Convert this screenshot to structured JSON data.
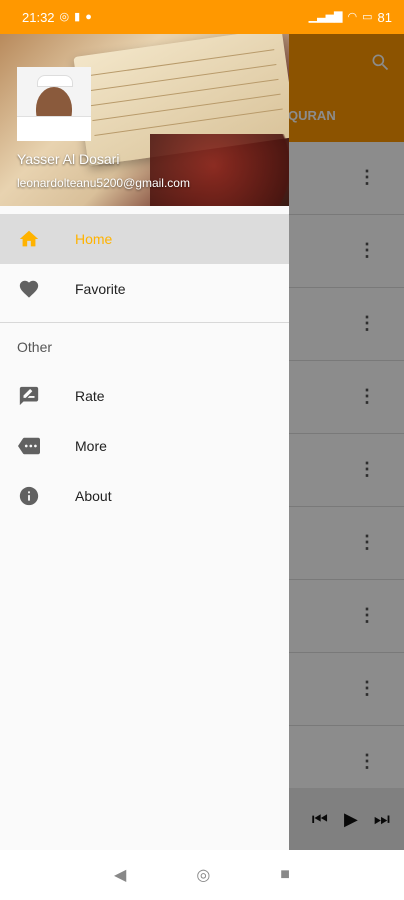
{
  "status": {
    "time": "21:32",
    "battery": "81"
  },
  "background": {
    "tab_title": "Y QURAN",
    "rows": 9
  },
  "drawer": {
    "user_name": "Yasser Al Dosari",
    "email": "leonardolteanu5200@gmail.com",
    "main_items": [
      {
        "label": "Home",
        "icon": "home-icon",
        "active": true
      },
      {
        "label": "Favorite",
        "icon": "heart-icon",
        "active": false
      }
    ],
    "other_title": "Other",
    "other_items": [
      {
        "label": "Rate",
        "icon": "rate-review-icon"
      },
      {
        "label": "More",
        "icon": "more-label-icon"
      },
      {
        "label": "About",
        "icon": "info-icon"
      }
    ]
  },
  "colors": {
    "accent": "#FF9800",
    "active_text": "#FFB300"
  }
}
